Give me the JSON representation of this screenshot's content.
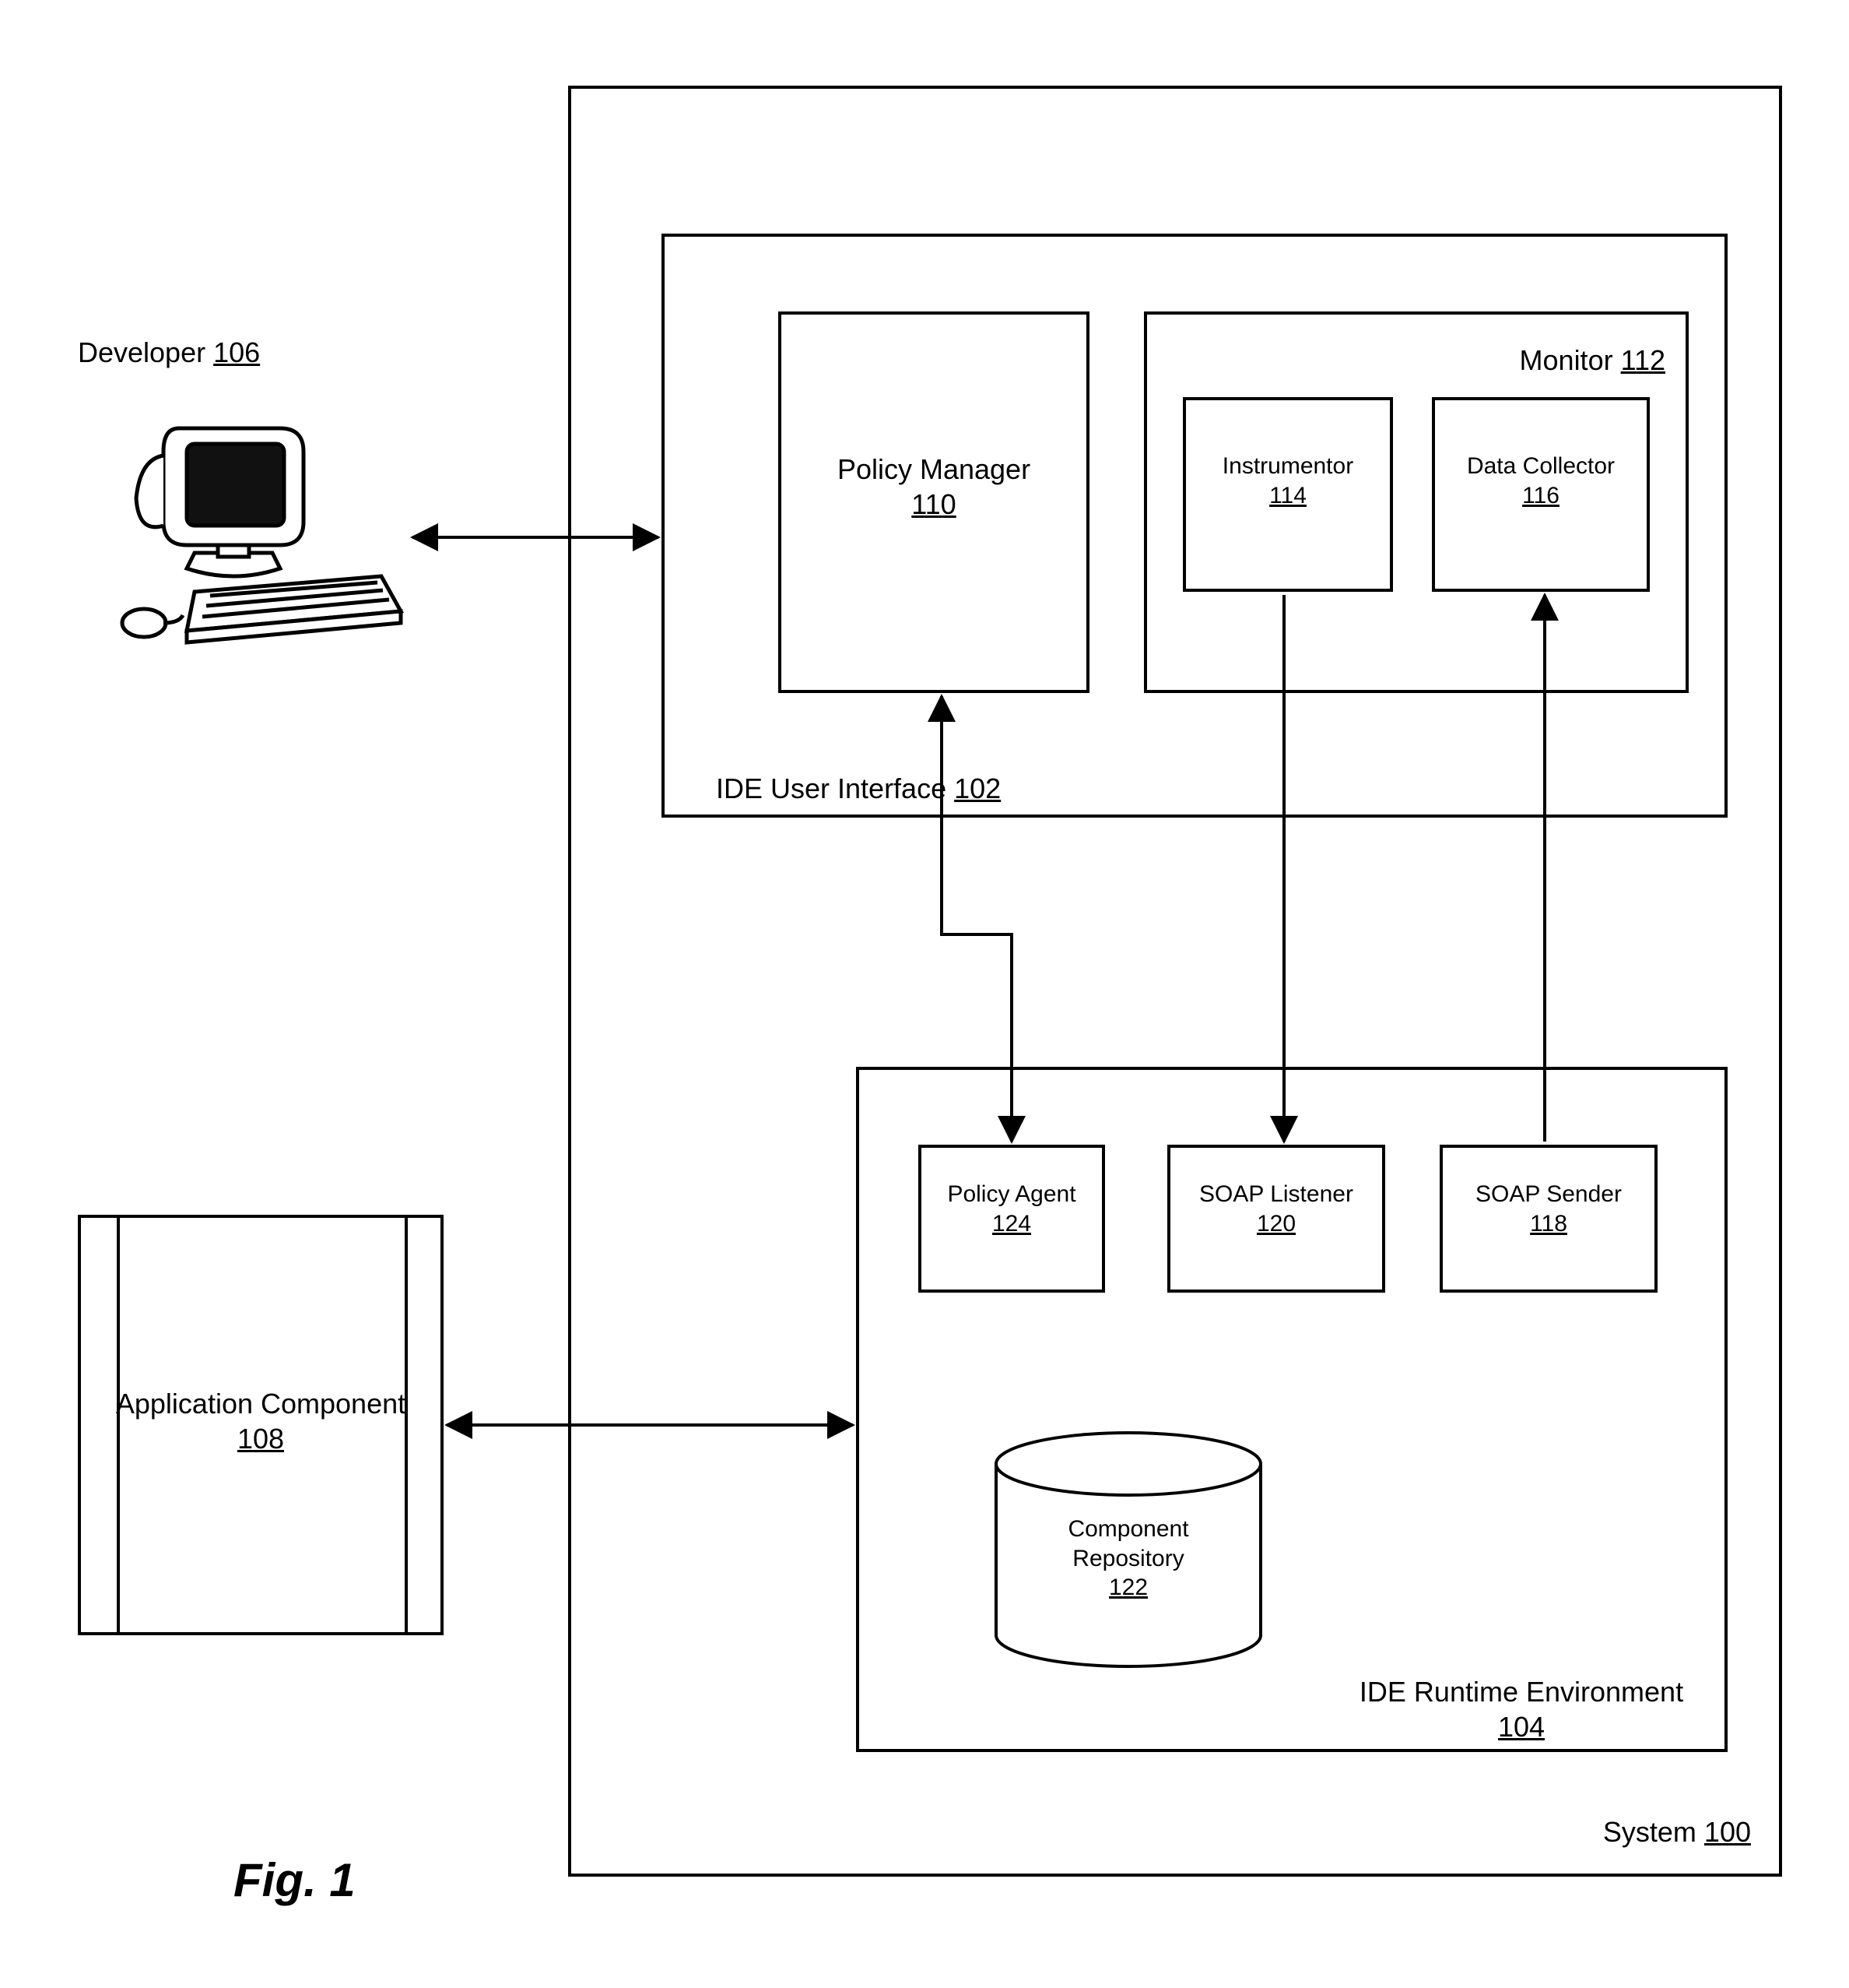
{
  "figure": "Fig. 1",
  "developer": {
    "name": "Developer",
    "num": "106"
  },
  "appComponent": {
    "name": "Application Component",
    "num": "108"
  },
  "system": {
    "name": "System",
    "num": "100"
  },
  "ideUI": {
    "name": "IDE User Interface",
    "num": "102"
  },
  "policyManager": {
    "name": "Policy Manager",
    "num": "110"
  },
  "monitor": {
    "name": "Monitor",
    "num": "112"
  },
  "instrumentor": {
    "name": "Instrumentor",
    "num": "114"
  },
  "dataCollector": {
    "name": "Data Collector",
    "num": "116"
  },
  "ideRuntime": {
    "name": "IDE Runtime Environment",
    "num": "104"
  },
  "policyAgent": {
    "name": "Policy Agent",
    "num": "124"
  },
  "soapListener": {
    "name": "SOAP Listener",
    "num": "120"
  },
  "soapSender": {
    "name": "SOAP Sender",
    "num": "118"
  },
  "componentRepo": {
    "name1": "Component",
    "name2": "Repository",
    "num": "122"
  }
}
